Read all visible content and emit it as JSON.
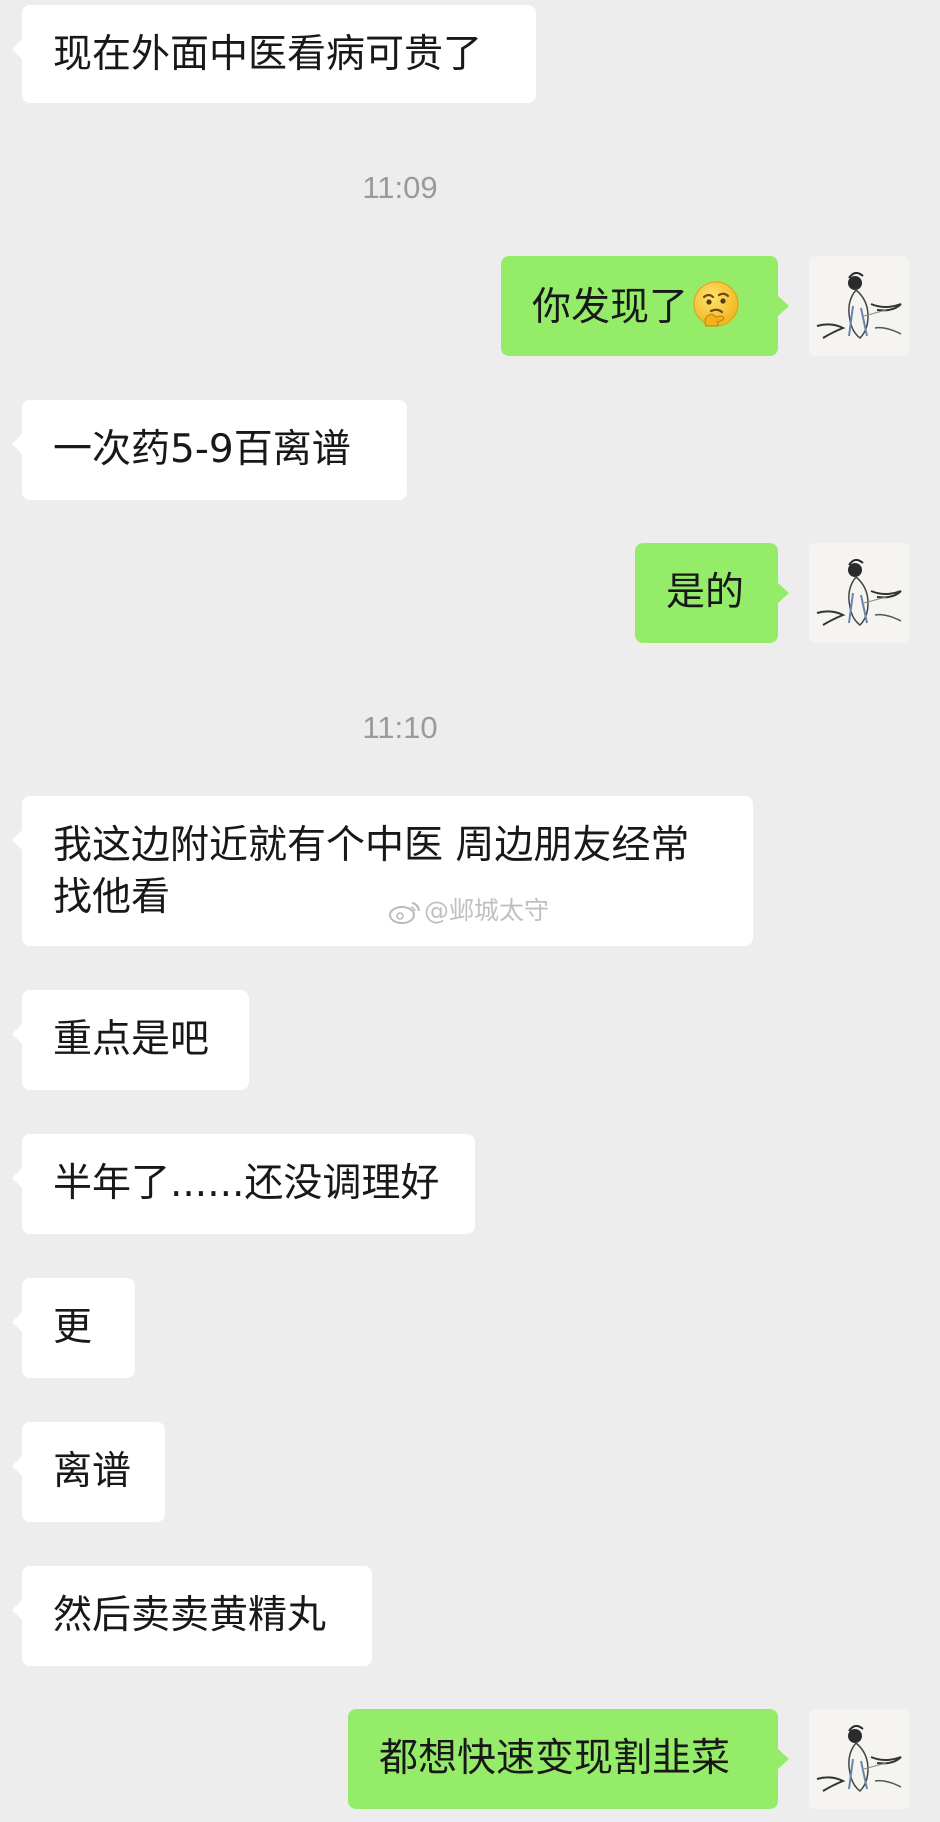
{
  "messages": {
    "m1": "现在外面中医看病可贵了",
    "t1": "11:09",
    "m2": "你发现了",
    "m3": "一次药5-9百离谱",
    "m4": "是的",
    "t2": "11:10",
    "m5": "我这边附近就有个中医 周边朋友经常找他看",
    "m6": "重点是吧",
    "m7": "半年了......还没调理好",
    "m8": "更",
    "m9": "离谱",
    "m10": "然后卖卖黄精丸",
    "m11": "都想快速变现割韭菜"
  },
  "watermark": "@邺城太守",
  "colors": {
    "background": "#ededed",
    "incoming_bubble": "#ffffff",
    "outgoing_bubble": "#95ec69",
    "timestamp": "#9a9a9a"
  },
  "icons": {
    "emoji": "thinking-face-emoji",
    "avatar": "ink-painting-avatar",
    "watermark": "weibo-logo-icon"
  }
}
